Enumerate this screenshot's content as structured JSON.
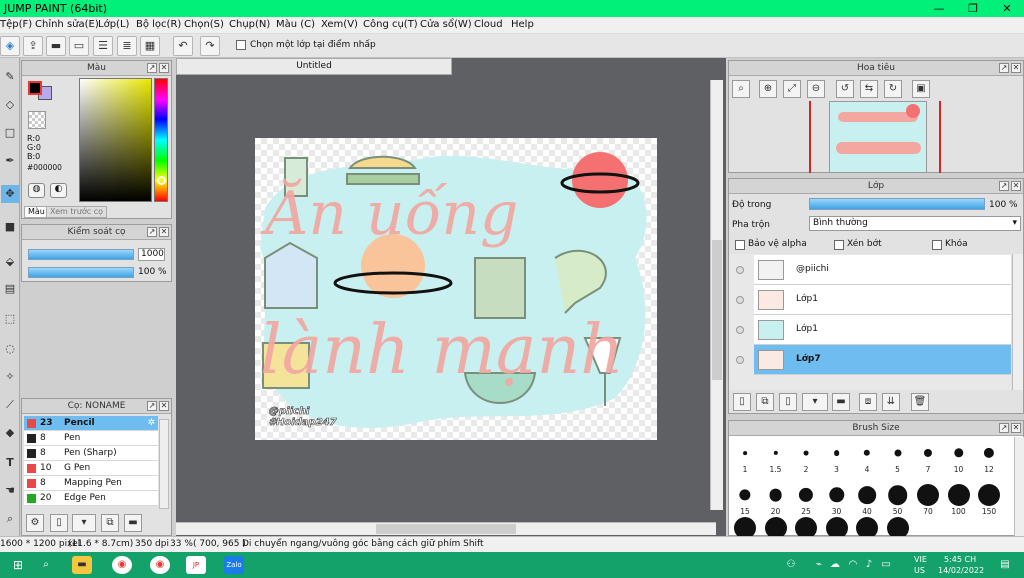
{
  "window": {
    "title": "JUMP PAINT (64bit)",
    "minimize_icon": "minimize-icon",
    "maximize_icon": "restore-icon",
    "close_icon": "close-icon"
  },
  "menu": [
    "Tệp(F)",
    "Chỉnh sửa(E)",
    "Lớp(L)",
    "Bộ lọc(R)",
    "Chọn(S)",
    "Chụp(N)",
    "Màu (C)",
    "Xem(V)",
    "Công cụ(T)",
    "Cửa sổ(W)",
    "Cloud",
    "Help"
  ],
  "toolbar": {
    "checkbox_label": "Chọn một lớp tại điểm nhấp"
  },
  "color_panel": {
    "title": "Màu",
    "r": "R:0",
    "g": "G:0",
    "b": "B:0",
    "hex": "#000000",
    "tab_color": "Màu",
    "tab_preview": "Xem trước cọ",
    "primary_color": "#000000",
    "secondary_color": "#b8a8ec"
  },
  "brush_control": {
    "title": "Kiểm soát cọ",
    "size_value": "1000",
    "opacity_value": "100 %",
    "size_level": 1.0,
    "opacity_level": 1.0
  },
  "brush_list": {
    "title": "Cọ: NONAME",
    "items": [
      {
        "num": "23",
        "name": "Pencil",
        "color": "#e84a4a"
      },
      {
        "num": "8",
        "name": "Pen",
        "color": "#222222"
      },
      {
        "num": "8",
        "name": "Pen (Sharp)",
        "color": "#222222"
      },
      {
        "num": "10",
        "name": "G Pen",
        "color": "#e84a4a"
      },
      {
        "num": "8",
        "name": "Mapping Pen",
        "color": "#e84a4a"
      },
      {
        "num": "20",
        "name": "Edge Pen",
        "color": "#22aa22"
      }
    ]
  },
  "document": {
    "tab": "Untitled",
    "watermark_line1": "@piichi",
    "watermark_line2": "#Hoidap247",
    "art_line1": "Ăn uống",
    "art_line2": "lành mạnh"
  },
  "navigator": {
    "title": "Hoa tiêu"
  },
  "layer_panel": {
    "title": "Lớp",
    "opacity_label": "Độ trong",
    "opacity_value": "100 %",
    "opacity_level": 1.0,
    "blend_label": "Pha trộn",
    "blend_value": "Bình thường",
    "protect_alpha": "Bảo vệ alpha",
    "clipping": "Xén bớt",
    "lock": "Khóa",
    "layers": [
      {
        "name": "@piichi",
        "selected": false
      },
      {
        "name": "Lớp1",
        "selected": false
      },
      {
        "name": "Lớp1",
        "selected": false
      },
      {
        "name": "Lớp7",
        "selected": true
      }
    ]
  },
  "brush_size": {
    "title": "Brush Size",
    "sizes": [
      "1",
      "1.5",
      "2",
      "3",
      "4",
      "5",
      "7",
      "10",
      "12",
      "15",
      "20",
      "25",
      "30",
      "40",
      "50",
      "70",
      "100",
      "150"
    ]
  },
  "status": {
    "dimensions": "1600 * 1200 pixel",
    "physical": "(11.6 * 8.7cm)",
    "dpi": "350 dpi",
    "zoom": "33 %",
    "cursor": "( 700, 965 )",
    "hint": "Di chuyển ngang/vuông góc bằng cách giữ phím Shift"
  },
  "taskbar": {
    "lang_top": "VIE",
    "lang_bottom": "US",
    "time": "5:45 CH",
    "date": "14/02/2022",
    "zalo": "Zalo"
  }
}
